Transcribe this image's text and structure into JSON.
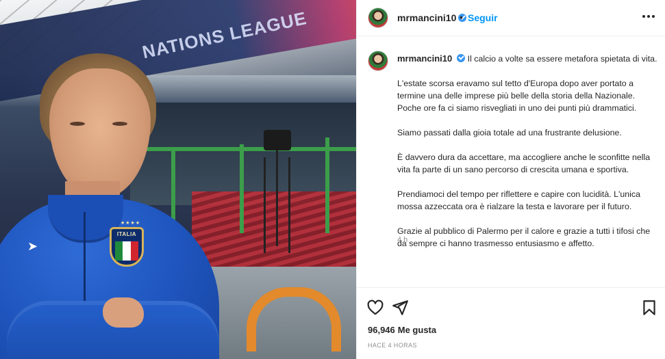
{
  "post": {
    "username": "mrmancini10",
    "separator": "•",
    "follow_label": "Seguir",
    "more_icon": "more-options-icon",
    "photo_banner_text": "NATIONS LEAGUE",
    "jersey_badge_text": "ITALIA",
    "caption": {
      "first_line": "Il calcio a volte sa essere metafora spietata di vita.",
      "paragraphs": [
        "L'estate scorsa eravamo sul tetto d'Europa dopo aver portato a termine una delle imprese più belle della storia della Nazionale. Poche ore fa ci siamo risvegliati in uno dei punti più drammatici.",
        "Siamo passati dalla gioia totale ad una frustrante delusione.",
        "È davvero dura da accettare, ma accogliere anche le sconfitte nella vita fa parte di un sano percorso di crescita umana e sportiva.",
        "Prendiamoci del tempo per riflettere e capire con lucidità. L'unica mossa azzeccata ora è rialzare la testa e lavorare per il futuro.",
        "Grazie al pubblico di Palermo per il calore e grazie a tutti i tifosi che da sempre ci hanno trasmesso entusiasmo e affetto."
      ],
      "relative_time": "4 h"
    },
    "likes_count": "96,946",
    "likes_label": "Me gusta",
    "timestamp": "HACE 4 HORAS",
    "icons": {
      "like": "heart-icon",
      "share": "send-icon",
      "save": "bookmark-icon",
      "verified": "verified-badge-icon"
    },
    "colors": {
      "follow": "#0095f6",
      "verified": "#3897f0",
      "secondary_text": "#8e8e8e"
    }
  }
}
